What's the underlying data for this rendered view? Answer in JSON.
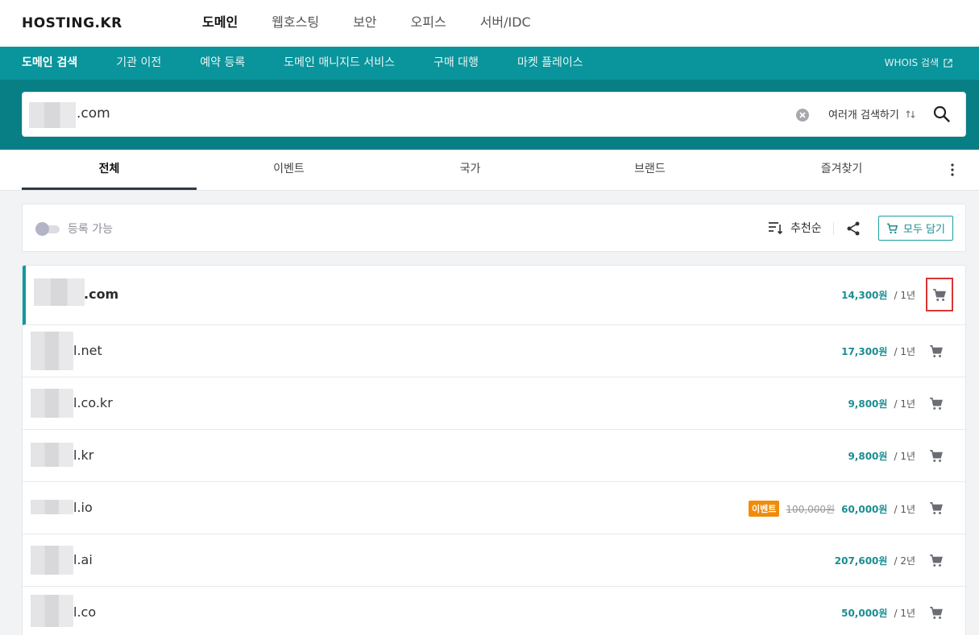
{
  "header": {
    "logo": "HOSTING.KR",
    "nav": [
      {
        "label": "도메인",
        "active": true
      },
      {
        "label": "웹호스팅",
        "active": false
      },
      {
        "label": "보안",
        "active": false
      },
      {
        "label": "오피스",
        "active": false
      },
      {
        "label": "서버/IDC",
        "active": false
      }
    ]
  },
  "subnav": {
    "items": [
      {
        "label": "도메인 검색",
        "active": true
      },
      {
        "label": "기관 이전",
        "active": false
      },
      {
        "label": "예약 등록",
        "active": false
      },
      {
        "label": "도메인 매니지드 서비스",
        "active": false
      },
      {
        "label": "구매 대행",
        "active": false
      },
      {
        "label": "마켓 플레이스",
        "active": false
      }
    ],
    "whois_label": "WHOIS 검색"
  },
  "search": {
    "query_suffix": ".com",
    "multi_search_label": "여러개 검색하기"
  },
  "tabs": [
    {
      "label": "전체",
      "active": true
    },
    {
      "label": "이벤트",
      "active": false
    },
    {
      "label": "국가",
      "active": false
    },
    {
      "label": "브랜드",
      "active": false
    },
    {
      "label": "즐겨찾기",
      "active": false
    }
  ],
  "filter": {
    "available_label": "등록 가능",
    "available_on": false,
    "sort_label": "추천순",
    "cart_all_label": "모두 담기"
  },
  "results": [
    {
      "name": ".com",
      "price": "14,300원",
      "period": "1년",
      "highlighted": true
    },
    {
      "name": "l.net",
      "price": "17,300원",
      "period": "1년"
    },
    {
      "name": "l.co.kr",
      "price": "9,800원",
      "period": "1년"
    },
    {
      "name": "l.kr",
      "price": "9,800원",
      "period": "1년"
    },
    {
      "name": "l.io",
      "badge": "이벤트",
      "old_price": "100,000원",
      "price": "60,000원",
      "period": "1년"
    },
    {
      "name": "l.ai",
      "price": "207,600원",
      "period": "2년"
    },
    {
      "name": "l.co",
      "price": "50,000원",
      "period": "1년"
    }
  ],
  "colors": {
    "accent": "#0a949b",
    "search_band": "#077f84",
    "price": "#1a8d92",
    "event_badge": "#f08c0a",
    "highlight_outline": "#d93535"
  }
}
